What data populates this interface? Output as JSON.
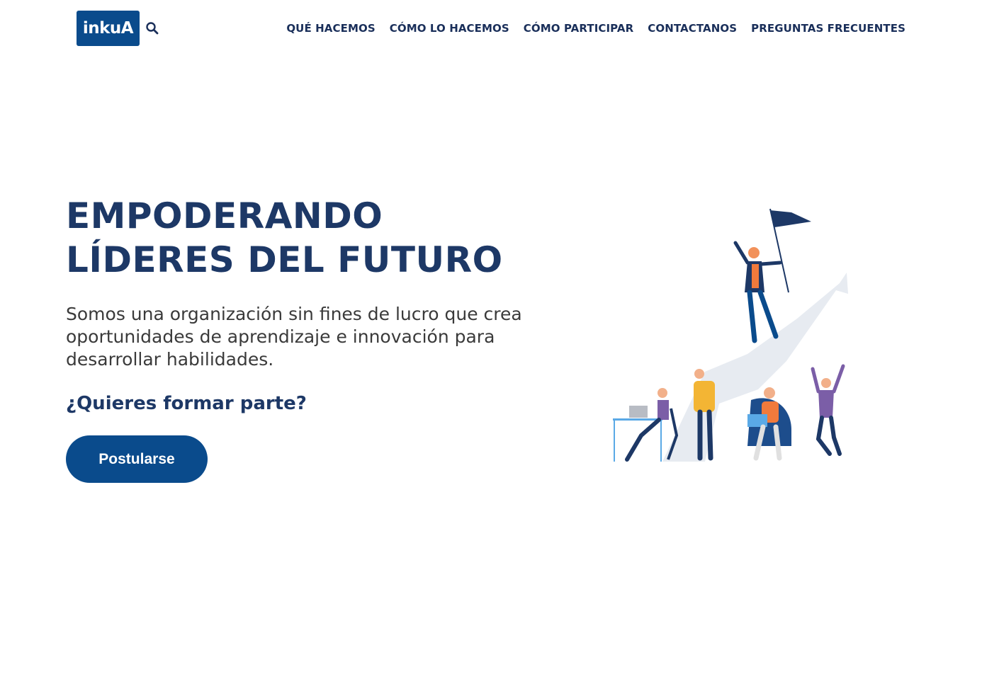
{
  "header": {
    "logo_text": "inkuA",
    "search_icon": "search-icon",
    "nav": [
      {
        "label": "QUÉ HACEMOS"
      },
      {
        "label": "CÓMO LO HACEMOS"
      },
      {
        "label": "CÓMO PARTICIPAR"
      },
      {
        "label": "CONTACTANOS"
      },
      {
        "label": "PREGUNTAS FRECUENTES"
      }
    ]
  },
  "hero": {
    "title_line1": "EMPODERANDO",
    "title_line2": "LÍDERES DEL FUTURO",
    "subtitle": "Somos una organización sin fines de lucro que crea oportunidades de aprendizaje e innovación para desarrollar habilidades.",
    "question": "¿Quieres formar parte?",
    "cta_label": "Postularse"
  },
  "colors": {
    "brand": "#0a4b8c",
    "heading": "#1d3866",
    "text": "#3a3a3a"
  }
}
